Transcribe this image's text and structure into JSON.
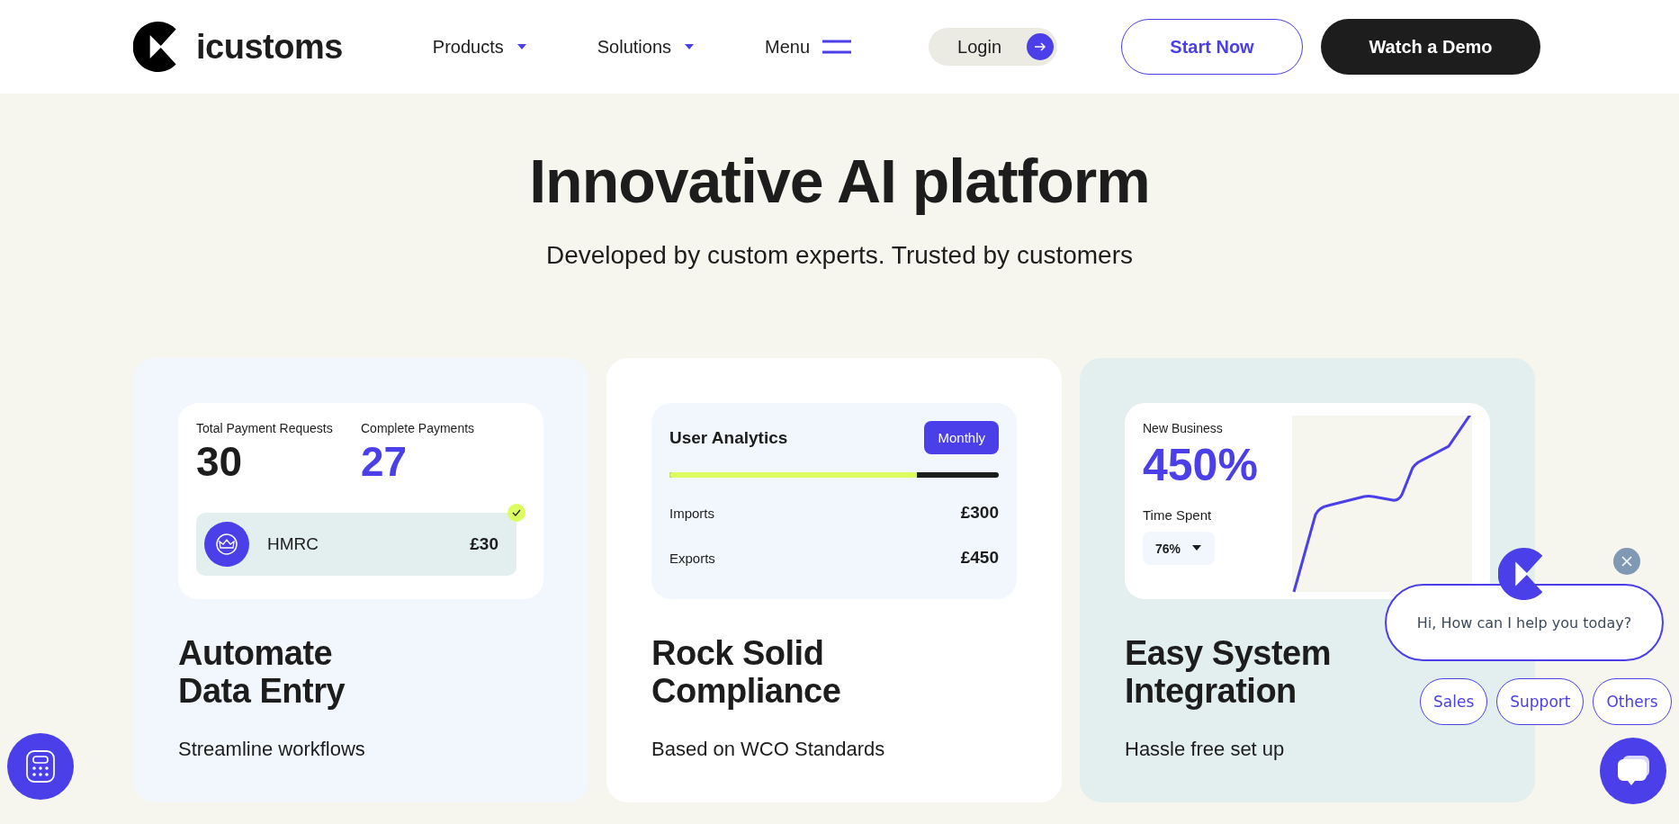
{
  "header": {
    "logo": "icustoms",
    "nav": [
      {
        "label": "Products",
        "kind": "dropdown"
      },
      {
        "label": "Solutions",
        "kind": "dropdown"
      },
      {
        "label": "Menu",
        "kind": "menu"
      }
    ],
    "login": "Login",
    "start_now": "Start Now",
    "watch_demo": "Watch a Demo"
  },
  "hero": {
    "title": "Innovative AI platform",
    "subtitle": "Developed by custom experts. Trusted by customers"
  },
  "cards": [
    {
      "kind": "payments",
      "heading": [
        "Automate",
        "Data Entry"
      ],
      "text": "Streamline workflows",
      "widget": {
        "stats": [
          {
            "label": "Total Payment Requests",
            "value": "30",
            "kind": "plain"
          },
          {
            "label": "Complete Payments",
            "value": "27",
            "kind": "accent"
          }
        ],
        "payee": {
          "name": "HMRC",
          "amount": "£30",
          "checked": true
        }
      }
    },
    {
      "kind": "analytics",
      "heading": [
        "Rock Solid",
        "Compliance"
      ],
      "text": "Based on WCO Standards",
      "widget": {
        "title": "User Analytics",
        "period": "Monthly",
        "level": 0.75,
        "rows": [
          {
            "label": "Imports",
            "value": "£300"
          },
          {
            "label": "Exports",
            "value": "£450"
          }
        ]
      }
    },
    {
      "kind": "growth",
      "heading": [
        "Easy System",
        "Integration"
      ],
      "text": "Hassle free set up",
      "widget": {
        "label": "New Business",
        "value": "450%",
        "sub_label": "Time Spent",
        "select": "76%"
      }
    }
  ],
  "chat": {
    "greeting": "Hi, How can I help you today?",
    "options": [
      "Sales",
      "Support",
      "Others"
    ]
  }
}
